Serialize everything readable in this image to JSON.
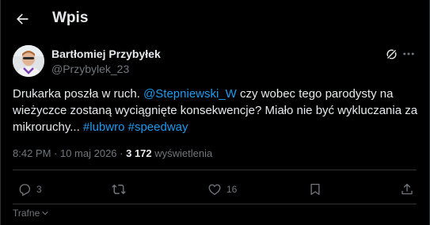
{
  "header": {
    "title": "Wpis",
    "back_icon": "arrow-left-icon"
  },
  "author": {
    "display_name": "Bartłomiej Przybyłek",
    "handle": "@Przybylek_23"
  },
  "tweet": {
    "text_1": "Drukarka poszła w ruch. ",
    "mention": "@Stepniewski_W",
    "text_2": " czy wobec tego parodysty na wieżyczce zostaną wyciągnięte konsekwencje? Miało nie być wykluczania za mikroruchy... ",
    "hashtag_1": "#lubwro",
    "text_3": " ",
    "hashtag_2": "#speedway"
  },
  "meta": {
    "time": "8:42 PM",
    "separator": " · ",
    "date": "10 maj 2026",
    "views_count": "3 172",
    "views_label": " wyświetlenia"
  },
  "actions": {
    "replies": "3",
    "likes": "16"
  },
  "sort": {
    "label": "Trafne"
  },
  "colors": {
    "accent": "#1d9bf0",
    "muted": "#71767b",
    "text": "#e7e9ea",
    "background": "#000000",
    "border": "#2f3336"
  }
}
